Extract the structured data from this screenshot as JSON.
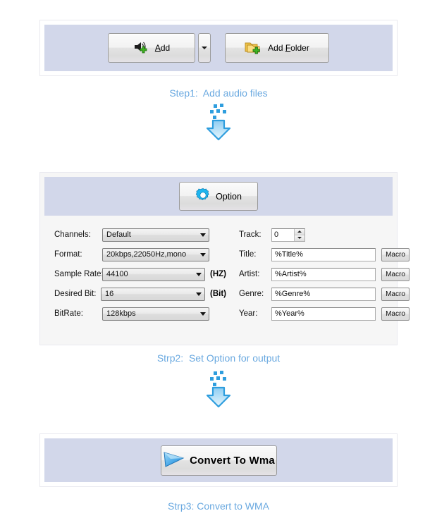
{
  "steps": [
    {
      "caption": "Step1:  Add audio files"
    },
    {
      "caption": "Strp2:  Set Option for output"
    },
    {
      "caption": "Strp3: Convert to WMA"
    }
  ],
  "step1": {
    "add_button": {
      "label": "Add",
      "accel_prefix": "",
      "accel_char": "A",
      "accel_suffix": "dd",
      "icon": "speaker-add-icon"
    },
    "add_dropdown": {
      "icon": "chevron-down-icon"
    },
    "add_folder_button": {
      "label": "Add Folder",
      "accel_prefix": "Add ",
      "accel_char": "F",
      "accel_suffix": "older",
      "icon": "folder-add-icon"
    }
  },
  "options": {
    "option_button": {
      "label": "Option",
      "icon": "gear-icon"
    },
    "left_fields": [
      {
        "label": "Channels:",
        "value": "Default",
        "unit": "",
        "control": "combo"
      },
      {
        "label": "Format:",
        "value": "20kbps,22050Hz,mono",
        "unit": "",
        "control": "combo"
      },
      {
        "label": "Sample Rate:",
        "value": "44100",
        "unit": "(HZ)",
        "control": "combo"
      },
      {
        "label": "Desired Bit:",
        "value": "16",
        "unit": "(Bit)",
        "control": "combo"
      },
      {
        "label": "BitRate:",
        "value": "128kbps",
        "unit": "",
        "control": "combo"
      }
    ],
    "right_fields": [
      {
        "label": "Track:",
        "value": "0",
        "control": "spinner",
        "macro": ""
      },
      {
        "label": "Title:",
        "value": "%Title%",
        "control": "text",
        "macro": "Macro"
      },
      {
        "label": "Artist:",
        "value": "%Artist%",
        "control": "text",
        "macro": "Macro"
      },
      {
        "label": "Genre:",
        "value": "%Genre%",
        "control": "text",
        "macro": "Macro"
      },
      {
        "label": "Year:",
        "value": "%Year%",
        "control": "text",
        "macro": "Macro"
      }
    ]
  },
  "step3": {
    "convert_button": {
      "label": "Convert To Wma",
      "icon": "play-arrow-icon"
    }
  },
  "colors": {
    "panel_fill": "#d2d7ea",
    "caption_blue": "#6aa9e0",
    "arrow_blue": "#3a9fe0",
    "body_bg": "#ffffff"
  }
}
